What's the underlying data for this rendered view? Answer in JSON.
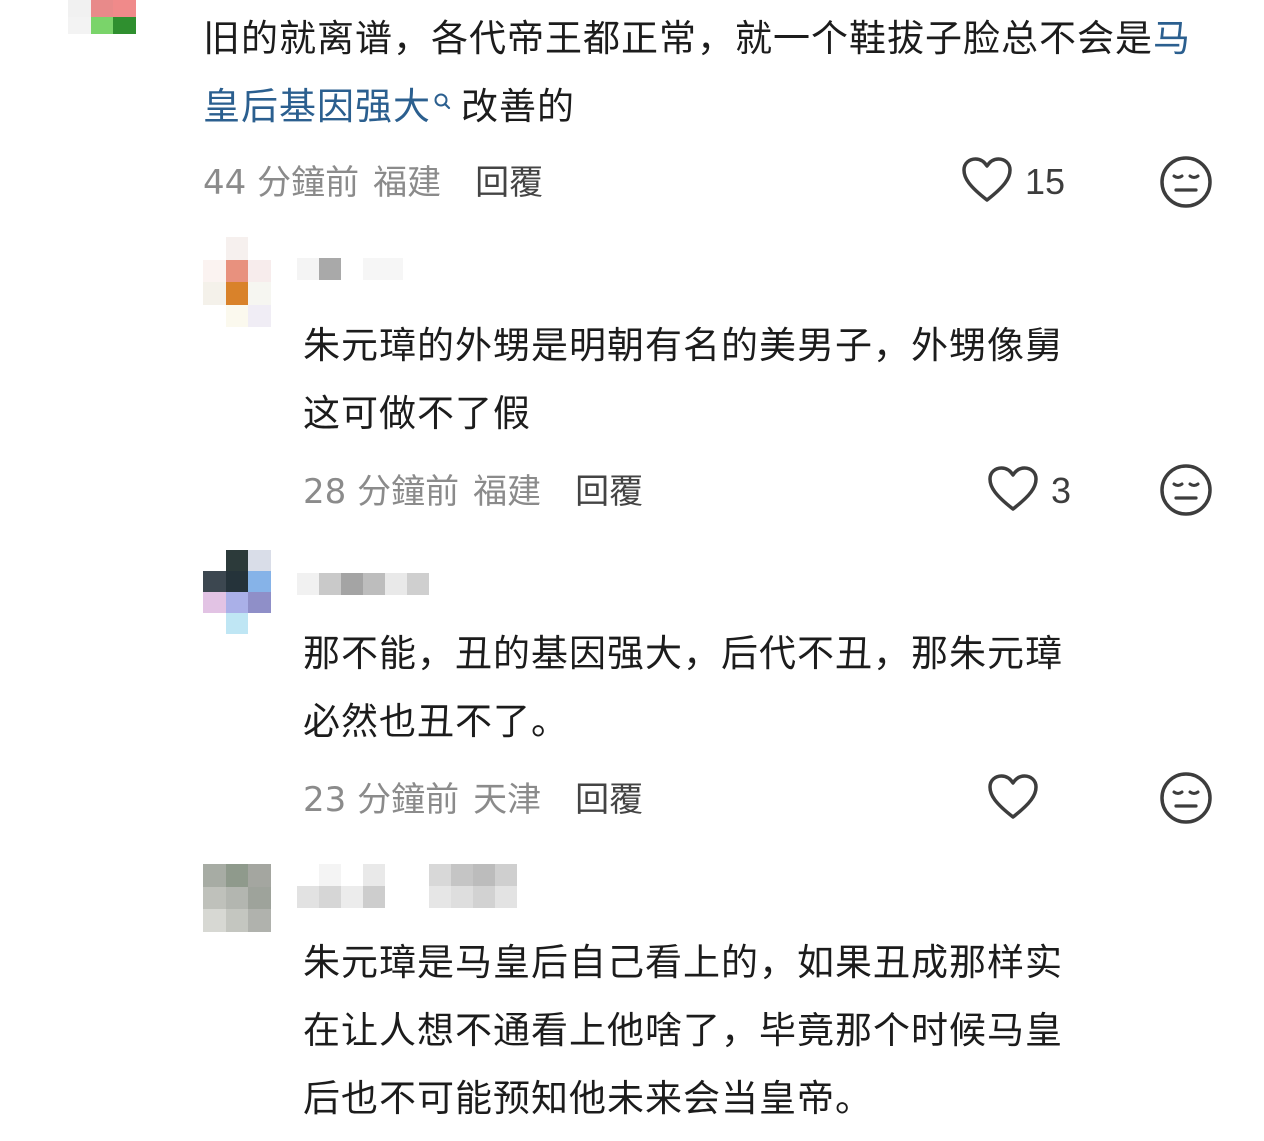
{
  "comments": [
    {
      "text_before": "旧的就离谱，各代帝王都正常，就一个鞋拔子脸总不会是",
      "link": "马皇后基因强大",
      "text_after": "改善的",
      "time": "44 分鐘前",
      "location": "福建",
      "reply_label": "回覆",
      "likes": "15"
    },
    {
      "line1": "朱元璋的外甥是明朝有名的美男子，外甥像舅",
      "line2": "这可做不了假",
      "time": "28 分鐘前",
      "location": "福建",
      "reply_label": "回覆",
      "likes": "3"
    },
    {
      "line1": "那不能，丑的基因强大，后代不丑，那朱元璋",
      "line2": "必然也丑不了。",
      "time": "23 分鐘前",
      "location": "天津",
      "reply_label": "回覆",
      "likes": ""
    },
    {
      "line1": "朱元璋是马皇后自己看上的，如果丑成那样实",
      "line2": "在让人想不通看上他啥了，毕竟那个时候马皇",
      "line3": "后也不可能预知他未来会当皇帝。"
    }
  ],
  "icons": {
    "like": "heart-outline-icon",
    "dislike": "meh-face-icon",
    "search": "search-icon"
  },
  "colors": {
    "link": "#2b5f8f",
    "meta": "#8b8b8b",
    "text": "#1c1c1c"
  }
}
